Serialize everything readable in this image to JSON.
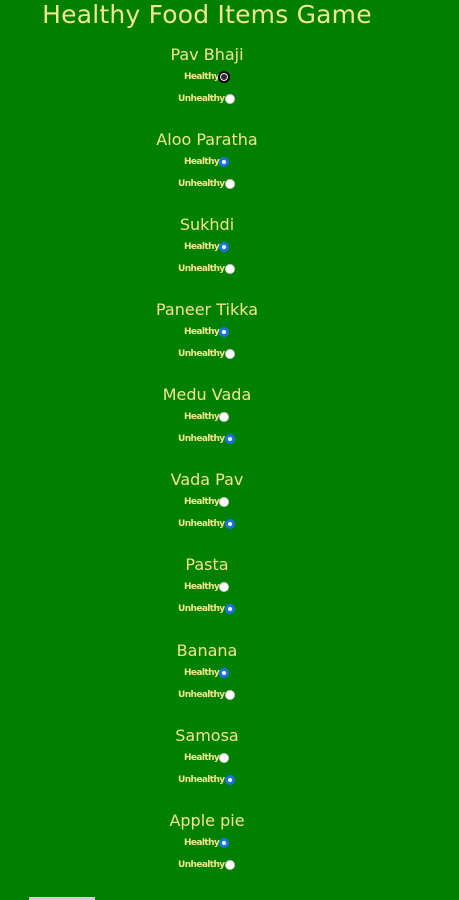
{
  "title": "Healthy Food Items Game",
  "labels": {
    "healthy": "Healthy",
    "unhealthy": "Unhealthy"
  },
  "colors": {
    "background": "#008000",
    "text": "#f0e68c",
    "radio_checked": "#1a73e8",
    "radio_unchecked": "#ffffff"
  },
  "items": [
    {
      "name": "Pav Bhaji",
      "selected": "none",
      "focused": "healthy"
    },
    {
      "name": "Aloo Paratha",
      "selected": "healthy"
    },
    {
      "name": "Sukhdi",
      "selected": "healthy"
    },
    {
      "name": "Paneer Tikka",
      "selected": "healthy"
    },
    {
      "name": "Medu Vada",
      "selected": "unhealthy"
    },
    {
      "name": "Vada Pav",
      "selected": "unhealthy"
    },
    {
      "name": "Pasta",
      "selected": "unhealthy"
    },
    {
      "name": "Banana",
      "selected": "healthy"
    },
    {
      "name": "Samosa",
      "selected": "unhealthy"
    },
    {
      "name": "Apple pie",
      "selected": "healthy"
    }
  ]
}
